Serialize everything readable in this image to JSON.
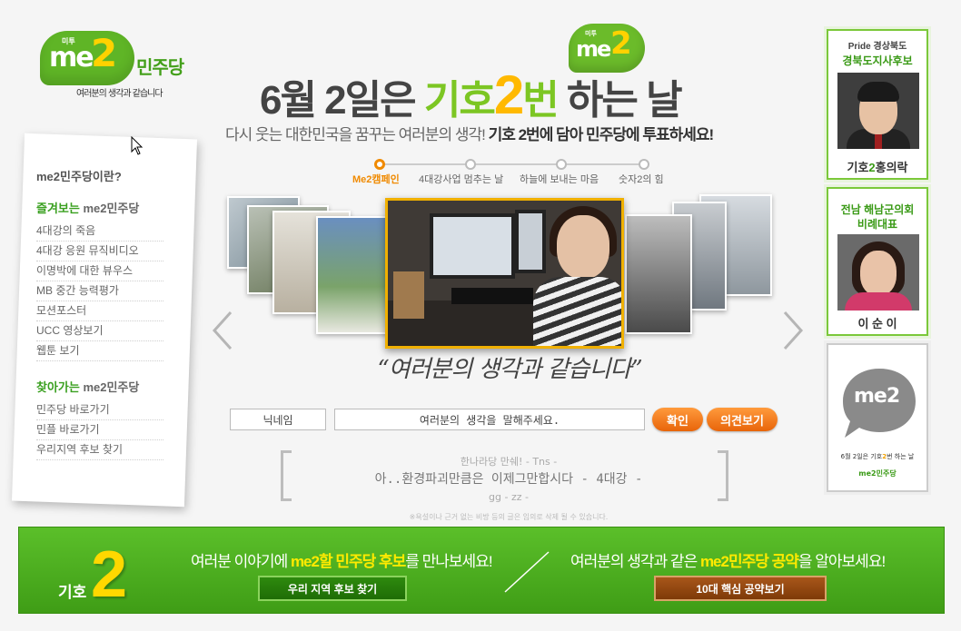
{
  "logo": {
    "mini": "미투",
    "me": "me",
    "two": "2",
    "party": "민주당",
    "tagline": "여러분의 생각과 같습니다"
  },
  "headline": {
    "part1": "6월 2일은 ",
    "part2": "기호",
    "part3": "2",
    "part4": "번",
    "part5": " 하는 날"
  },
  "badge": {
    "mini": "미투",
    "me": "me",
    "two": "2"
  },
  "subhead": {
    "plain": "다시 웃는 대한민국을 꿈꾸는 여러분의 생각! ",
    "bold": "기호 2번에 담아 민주당에 투표하세요!"
  },
  "menu": {
    "title": "me2민주당이란?",
    "section1": {
      "green": "즐겨보는",
      "gray": " me2민주당"
    },
    "section1_items": [
      "4대강의 죽음",
      "4대강 응원 뮤직비디오",
      "이명박에 대한 뷰우스",
      "MB 중간 능력평가",
      "모션포스터",
      "UCC 영상보기",
      "웹툰 보기"
    ],
    "section2": {
      "green": "찾아가는",
      "gray": " me2민주당"
    },
    "section2_items": [
      "민주당 바로가기",
      "민플 바로가기",
      "우리지역 후보 찾기"
    ]
  },
  "steps": [
    "Me2캠페인",
    "4대강사업 멈추는 날",
    "하늘에 보내는 마음",
    "숫자2의 힘"
  ],
  "slogan": "“여러분의 생각과 같습니다”",
  "form": {
    "nickname_value": "닉네임",
    "opinion_value": "여러분의 생각을 말해주세요.",
    "confirm_label": "확인",
    "view_label": "의견보기"
  },
  "comments": {
    "line1": "한나라당 만쉐! - Tns -",
    "line2": "아..환경파괴만큼은 이제그만합시다 - 4대강 -",
    "line3": "gg - zz -",
    "notice": "※욕설이나 근거 없는 비방 등의 글은 임의로 삭제 될 수 있습니다."
  },
  "candidates": [
    {
      "logo": "Pride 경상북도",
      "title": "경북도지사후보",
      "name_pre": "기호",
      "name_num": "2",
      "name_post": "홍의락"
    },
    {
      "title_l1": "전남 해남군의회",
      "title_l2": "비례대표",
      "name": "이 순 이"
    },
    {
      "logo": "me2",
      "caption_a": "6월 2일은 기호",
      "caption_b": "2",
      "caption_c": "번 하는 날",
      "party": "me2민주당"
    }
  ],
  "banner": {
    "hoho": "기호",
    "two": "2",
    "t1_a": "여러분 이야기에 ",
    "t1_b": "me2할 민주당 후보",
    "t1_c": "를 만나보세요!",
    "t2_a": "여러분의 생각과 같은 ",
    "t2_b": "me2민주당 공약",
    "t2_c": "을 알아보세요!",
    "btn_local": "우리 지역 후보 찾기",
    "btn_pledge": "10대 핵심 공약보기"
  },
  "colors": {
    "green": "#5fb526",
    "accent_orange": "#f08a00",
    "yellow": "#ffd200",
    "banner_green": "#4aad1e"
  }
}
